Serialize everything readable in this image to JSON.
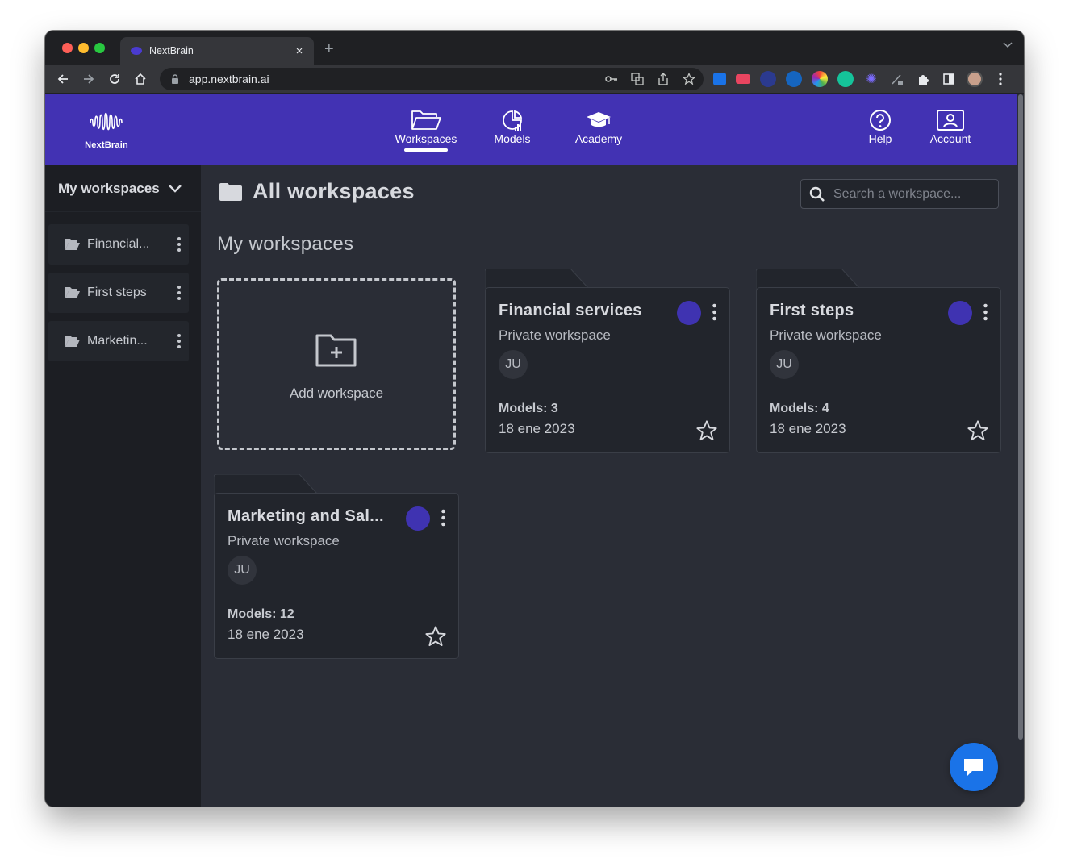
{
  "browser": {
    "tab_title": "NextBrain",
    "tab_close": "×",
    "new_tab": "+",
    "url": "app.nextbrain.ai"
  },
  "header": {
    "logo_text": "NextBrain",
    "nav": [
      {
        "label": "Workspaces",
        "active": true
      },
      {
        "label": "Models",
        "active": false
      },
      {
        "label": "Academy",
        "active": false
      }
    ],
    "right": [
      {
        "label": "Help"
      },
      {
        "label": "Account"
      }
    ],
    "accent_color": "#4232b3"
  },
  "sidebar": {
    "title": "My workspaces",
    "items": [
      {
        "label": "Financial..."
      },
      {
        "label": "First steps"
      },
      {
        "label": "Marketin..."
      }
    ]
  },
  "main": {
    "page_title": "All workspaces",
    "search_placeholder": "Search a workspace...",
    "section_title": "My workspaces",
    "add_label": "Add workspace",
    "cards": [
      {
        "title": "Financial services",
        "subtitle": "Private workspace",
        "avatar": "JU",
        "models": "Models: 3",
        "date": "18 ene 2023",
        "dot_color": "#3f33b1"
      },
      {
        "title": "First steps",
        "subtitle": "Private workspace",
        "avatar": "JU",
        "models": "Models: 4",
        "date": "18 ene 2023",
        "dot_color": "#3f33b1"
      },
      {
        "title": "Marketing and Sal...",
        "subtitle": "Private workspace",
        "avatar": "JU",
        "models": "Models: 12",
        "date": "18 ene 2023",
        "dot_color": "#3f33b1"
      }
    ]
  }
}
